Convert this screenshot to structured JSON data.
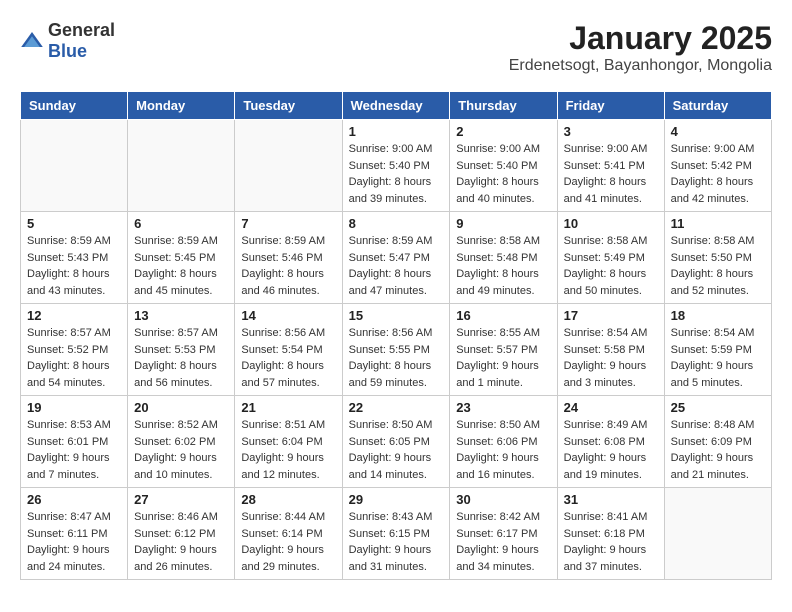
{
  "header": {
    "logo": {
      "text_general": "General",
      "text_blue": "Blue"
    },
    "title": "January 2025",
    "subtitle": "Erdenetsogt, Bayanhongor, Mongolia"
  },
  "weekdays": [
    "Sunday",
    "Monday",
    "Tuesday",
    "Wednesday",
    "Thursday",
    "Friday",
    "Saturday"
  ],
  "weeks": [
    [
      {
        "day": "",
        "info": ""
      },
      {
        "day": "",
        "info": ""
      },
      {
        "day": "",
        "info": ""
      },
      {
        "day": "1",
        "info": "Sunrise: 9:00 AM\nSunset: 5:40 PM\nDaylight: 8 hours\nand 39 minutes."
      },
      {
        "day": "2",
        "info": "Sunrise: 9:00 AM\nSunset: 5:40 PM\nDaylight: 8 hours\nand 40 minutes."
      },
      {
        "day": "3",
        "info": "Sunrise: 9:00 AM\nSunset: 5:41 PM\nDaylight: 8 hours\nand 41 minutes."
      },
      {
        "day": "4",
        "info": "Sunrise: 9:00 AM\nSunset: 5:42 PM\nDaylight: 8 hours\nand 42 minutes."
      }
    ],
    [
      {
        "day": "5",
        "info": "Sunrise: 8:59 AM\nSunset: 5:43 PM\nDaylight: 8 hours\nand 43 minutes."
      },
      {
        "day": "6",
        "info": "Sunrise: 8:59 AM\nSunset: 5:45 PM\nDaylight: 8 hours\nand 45 minutes."
      },
      {
        "day": "7",
        "info": "Sunrise: 8:59 AM\nSunset: 5:46 PM\nDaylight: 8 hours\nand 46 minutes."
      },
      {
        "day": "8",
        "info": "Sunrise: 8:59 AM\nSunset: 5:47 PM\nDaylight: 8 hours\nand 47 minutes."
      },
      {
        "day": "9",
        "info": "Sunrise: 8:58 AM\nSunset: 5:48 PM\nDaylight: 8 hours\nand 49 minutes."
      },
      {
        "day": "10",
        "info": "Sunrise: 8:58 AM\nSunset: 5:49 PM\nDaylight: 8 hours\nand 50 minutes."
      },
      {
        "day": "11",
        "info": "Sunrise: 8:58 AM\nSunset: 5:50 PM\nDaylight: 8 hours\nand 52 minutes."
      }
    ],
    [
      {
        "day": "12",
        "info": "Sunrise: 8:57 AM\nSunset: 5:52 PM\nDaylight: 8 hours\nand 54 minutes."
      },
      {
        "day": "13",
        "info": "Sunrise: 8:57 AM\nSunset: 5:53 PM\nDaylight: 8 hours\nand 56 minutes."
      },
      {
        "day": "14",
        "info": "Sunrise: 8:56 AM\nSunset: 5:54 PM\nDaylight: 8 hours\nand 57 minutes."
      },
      {
        "day": "15",
        "info": "Sunrise: 8:56 AM\nSunset: 5:55 PM\nDaylight: 8 hours\nand 59 minutes."
      },
      {
        "day": "16",
        "info": "Sunrise: 8:55 AM\nSunset: 5:57 PM\nDaylight: 9 hours\nand 1 minute."
      },
      {
        "day": "17",
        "info": "Sunrise: 8:54 AM\nSunset: 5:58 PM\nDaylight: 9 hours\nand 3 minutes."
      },
      {
        "day": "18",
        "info": "Sunrise: 8:54 AM\nSunset: 5:59 PM\nDaylight: 9 hours\nand 5 minutes."
      }
    ],
    [
      {
        "day": "19",
        "info": "Sunrise: 8:53 AM\nSunset: 6:01 PM\nDaylight: 9 hours\nand 7 minutes."
      },
      {
        "day": "20",
        "info": "Sunrise: 8:52 AM\nSunset: 6:02 PM\nDaylight: 9 hours\nand 10 minutes."
      },
      {
        "day": "21",
        "info": "Sunrise: 8:51 AM\nSunset: 6:04 PM\nDaylight: 9 hours\nand 12 minutes."
      },
      {
        "day": "22",
        "info": "Sunrise: 8:50 AM\nSunset: 6:05 PM\nDaylight: 9 hours\nand 14 minutes."
      },
      {
        "day": "23",
        "info": "Sunrise: 8:50 AM\nSunset: 6:06 PM\nDaylight: 9 hours\nand 16 minutes."
      },
      {
        "day": "24",
        "info": "Sunrise: 8:49 AM\nSunset: 6:08 PM\nDaylight: 9 hours\nand 19 minutes."
      },
      {
        "day": "25",
        "info": "Sunrise: 8:48 AM\nSunset: 6:09 PM\nDaylight: 9 hours\nand 21 minutes."
      }
    ],
    [
      {
        "day": "26",
        "info": "Sunrise: 8:47 AM\nSunset: 6:11 PM\nDaylight: 9 hours\nand 24 minutes."
      },
      {
        "day": "27",
        "info": "Sunrise: 8:46 AM\nSunset: 6:12 PM\nDaylight: 9 hours\nand 26 minutes."
      },
      {
        "day": "28",
        "info": "Sunrise: 8:44 AM\nSunset: 6:14 PM\nDaylight: 9 hours\nand 29 minutes."
      },
      {
        "day": "29",
        "info": "Sunrise: 8:43 AM\nSunset: 6:15 PM\nDaylight: 9 hours\nand 31 minutes."
      },
      {
        "day": "30",
        "info": "Sunrise: 8:42 AM\nSunset: 6:17 PM\nDaylight: 9 hours\nand 34 minutes."
      },
      {
        "day": "31",
        "info": "Sunrise: 8:41 AM\nSunset: 6:18 PM\nDaylight: 9 hours\nand 37 minutes."
      },
      {
        "day": "",
        "info": ""
      }
    ]
  ]
}
